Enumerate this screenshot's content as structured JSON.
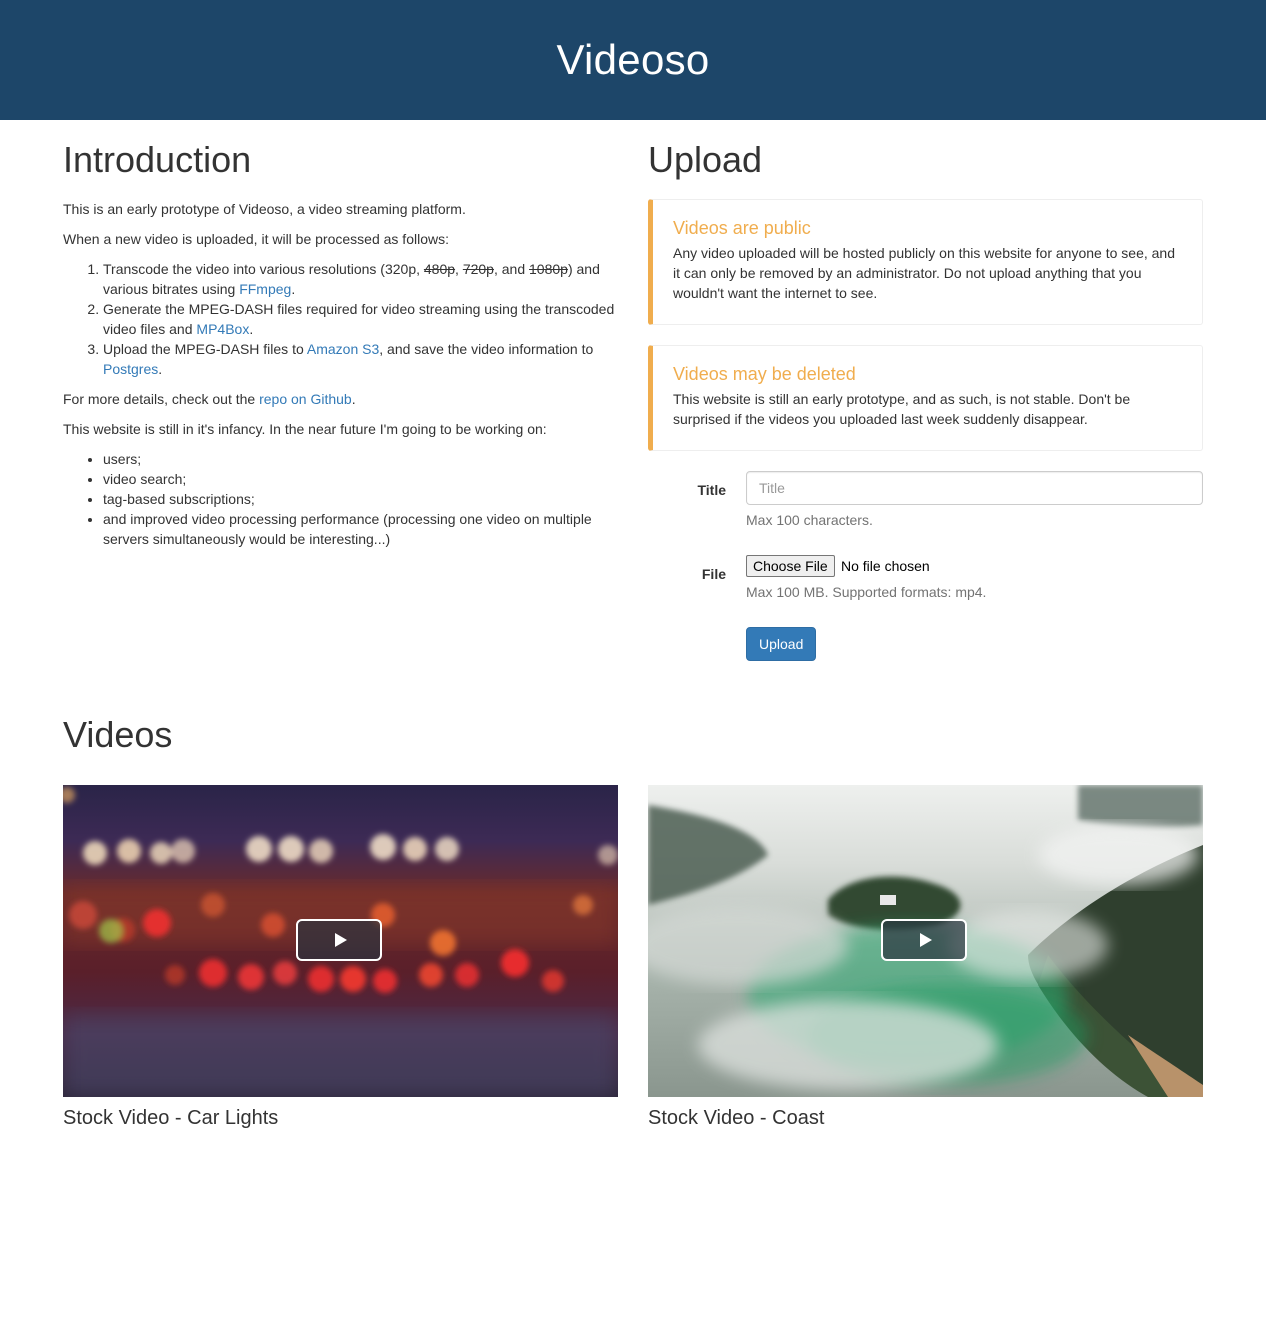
{
  "header": {
    "title": "Videoso"
  },
  "intro": {
    "heading": "Introduction",
    "p1": "This is an early prototype of Videoso, a video streaming platform.",
    "p2": "When a new video is uploaded, it will be processed as follows:",
    "steps": [
      {
        "a": "Transcode the video into various resolutions (320p, ",
        "s1": "480p",
        "sep1": ", ",
        "s2": "720p",
        "sep2": ", and ",
        "s3": "1080p",
        "b": ") and various bitrates using ",
        "link": "FFmpeg",
        "c": "."
      },
      {
        "a": "Generate the MPEG-DASH files required for video streaming using the transcoded video files and ",
        "link": "MP4Box",
        "c": "."
      },
      {
        "a": "Upload the MPEG-DASH files to ",
        "link1": "Amazon S3",
        "b": ", and save the video information to ",
        "link2": "Postgres",
        "c": "."
      }
    ],
    "p3_a": "For more details, check out the ",
    "p3_link": "repo on Github",
    "p3_b": ".",
    "p4": "This website is still in it's infancy. In the near future I'm going to be working on:",
    "todo": [
      "users;",
      "video search;",
      "tag-based subscriptions;",
      "and improved video processing performance (processing one video on multiple servers simultaneously would be interesting...)"
    ]
  },
  "upload": {
    "heading": "Upload",
    "alerts": [
      {
        "title": "Videos are public",
        "text": "Any video uploaded will be hosted publicly on this website for anyone to see, and it can only be removed by an administrator. Do not upload anything that you wouldn't want the internet to see."
      },
      {
        "title": "Videos may be deleted",
        "text": "This website is still an early prototype, and as such, is not stable. Don't be surprised if the videos you uploaded last week suddenly disappear."
      }
    ],
    "title_label": "Title",
    "title_placeholder": "Title",
    "title_value": "",
    "title_help": "Max 100 characters.",
    "file_label": "File",
    "file_button": "Choose File",
    "file_status": "No file chosen",
    "file_help": "Max 100 MB. Supported formats: mp4.",
    "submit_label": "Upload"
  },
  "videos": {
    "heading": "Videos",
    "items": [
      {
        "title": "Stock Video - Car Lights"
      },
      {
        "title": "Stock Video - Coast"
      }
    ]
  },
  "colors": {
    "header_bg": "#1d4669",
    "link": "#337ab7",
    "warning": "#f0ad4e",
    "primary_button": "#337ab7"
  }
}
